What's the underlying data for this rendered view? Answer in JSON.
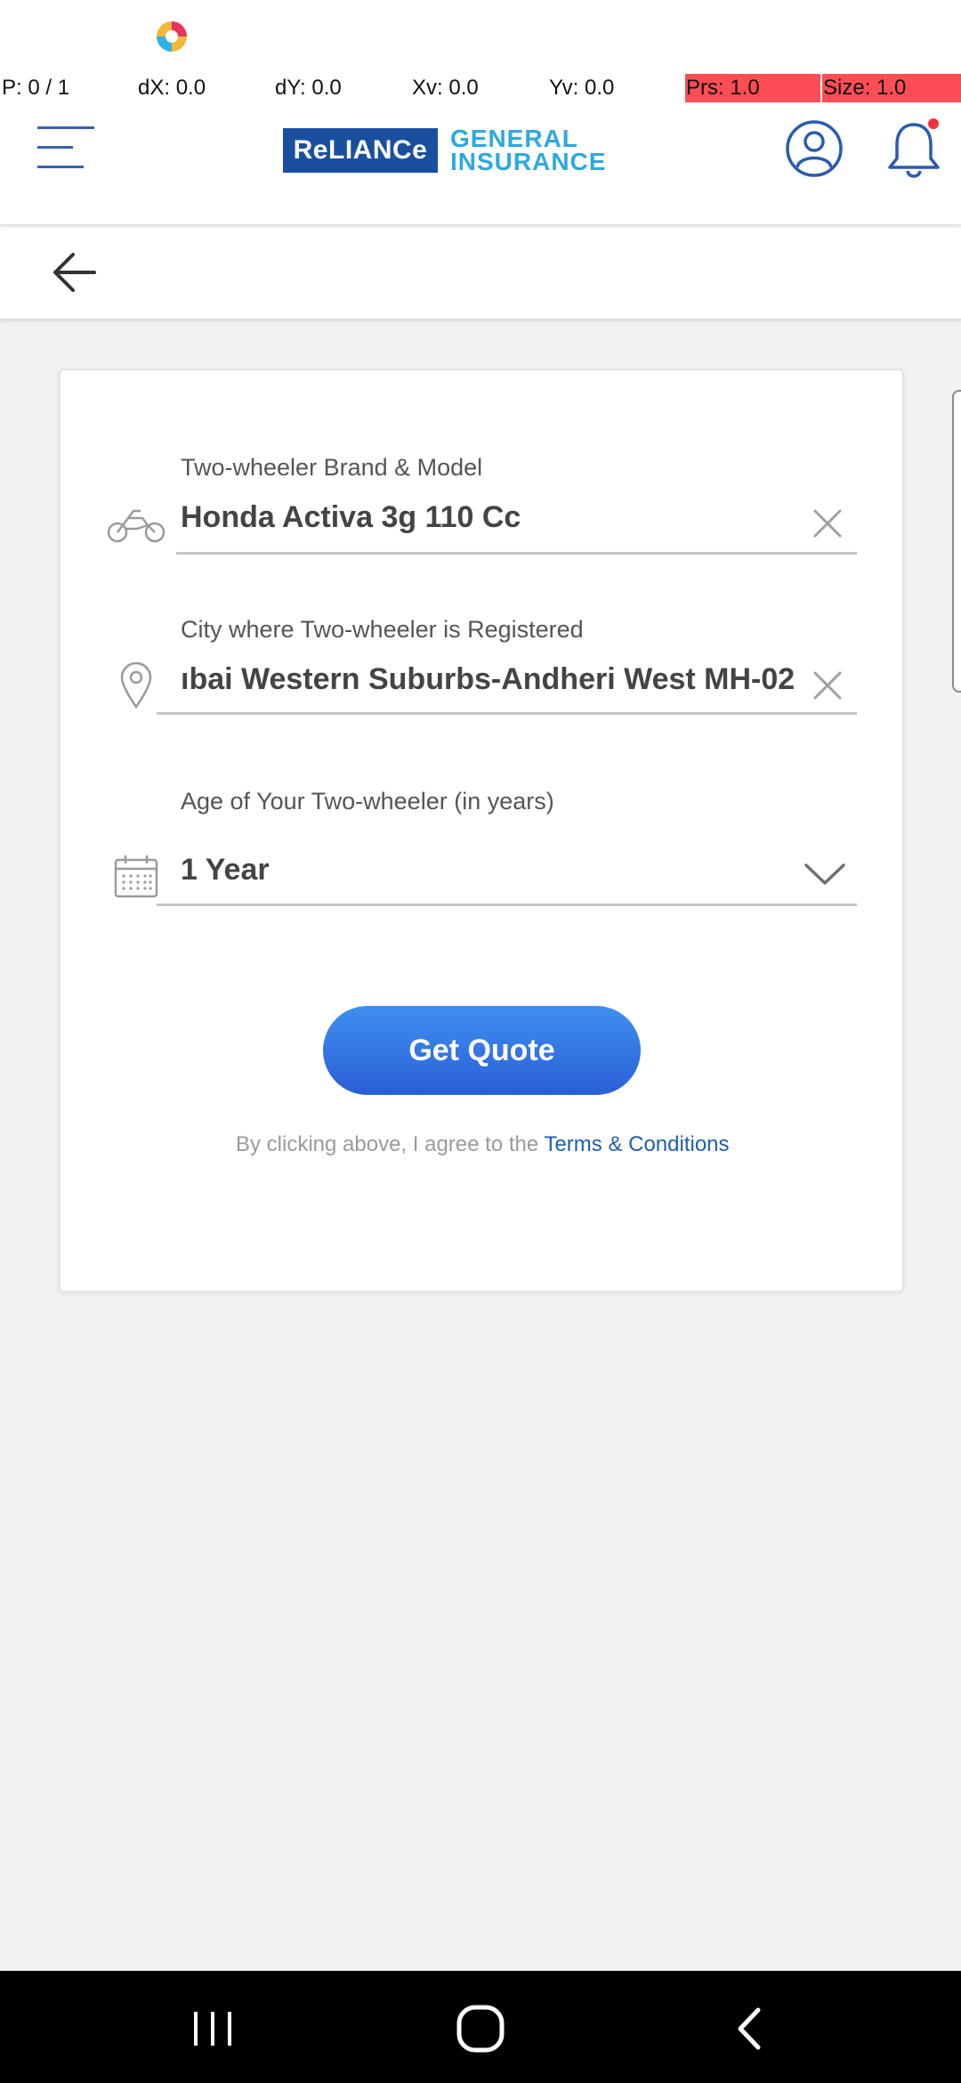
{
  "debug": {
    "pointer": "P: 0 / 1",
    "dx": "dX: 0.0",
    "dy": "dY: 0.0",
    "xv": "Xv: 0.0",
    "yv": "Yv: 0.0",
    "prs": "Prs: 1.0",
    "size": "Size: 1.0"
  },
  "header": {
    "brand_box": "ReLIANCe",
    "brand_line1": "GENERAL",
    "brand_line2": "INSURANCE"
  },
  "form": {
    "vehicle": {
      "label": "Two-wheeler Brand & Model",
      "value": "Honda Activa 3g 110 Cc",
      "icon": "motorcycle-icon"
    },
    "city": {
      "label": "City where Two-wheeler is Registered",
      "value": "ıbai Western Suburbs-Andheri West MH-02",
      "icon": "location-pin-icon"
    },
    "age": {
      "label": "Age of Your Two-wheeler (in years)",
      "value": "1 Year",
      "icon": "calendar-icon"
    },
    "submit_label": "Get Quote",
    "agree_text": "By clicking above, I agree to the ",
    "terms_link": "Terms & Conditions"
  },
  "colors": {
    "brand_blue": "#1a4fa0",
    "brand_cyan": "#2fa8e0",
    "button_gradient_top": "#3e8ff0",
    "button_gradient_bottom": "#2a5fd6",
    "notification_dot": "#f0323c",
    "debug_highlight": "#ff4d55"
  }
}
